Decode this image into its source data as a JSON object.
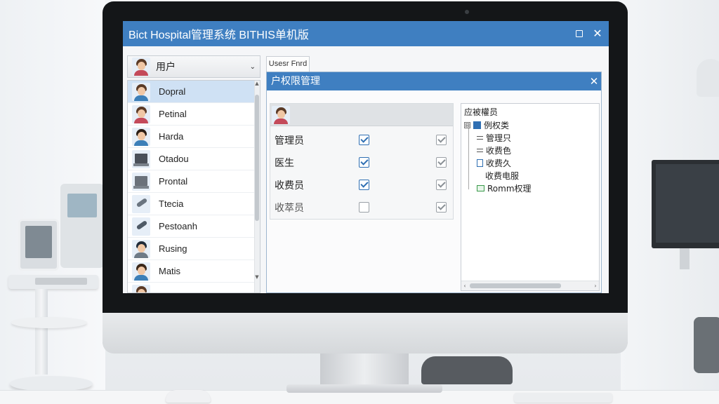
{
  "window": {
    "title": "Bict Hospital管理系统 BITHIS单机版",
    "maximize_label": "",
    "close_label": "✕"
  },
  "user_selector": {
    "label": "用户",
    "chevron": "⌄"
  },
  "user_list": [
    {
      "name": "Dopral",
      "avatar": "doctor-male"
    },
    {
      "name": "Petinal",
      "avatar": "person-female"
    },
    {
      "name": "Harda",
      "avatar": "person-female"
    },
    {
      "name": "Otadou",
      "avatar": "device"
    },
    {
      "name": "Prontal",
      "avatar": "device"
    },
    {
      "name": "Ttecia",
      "avatar": "tool"
    },
    {
      "name": "Pestoanh",
      "avatar": "tool"
    },
    {
      "name": "Rusing",
      "avatar": "person-male"
    },
    {
      "name": "Matis",
      "avatar": "person-male"
    }
  ],
  "tab": {
    "label": "Usesr Fnrd"
  },
  "dialog": {
    "title": "户权限管理",
    "close_label": "✕",
    "roles": [
      {
        "name": "管理员",
        "checked": true,
        "checked_right": true
      },
      {
        "name": "医生",
        "checked": true,
        "checked_right": true
      },
      {
        "name": "收费员",
        "checked": true,
        "checked_right": true
      },
      {
        "name": "收萃员",
        "checked": false,
        "checked_right": true
      }
    ],
    "tree": {
      "heading": "应被權员",
      "nodes": [
        {
          "label": "例权类",
          "expander": "⊟"
        },
        {
          "label": "管理只"
        },
        {
          "label": "收费色"
        },
        {
          "label": "收费久"
        },
        {
          "label": "收费电服"
        },
        {
          "label": "Romm权理"
        }
      ],
      "scroll_left": "‹",
      "scroll_right": "›"
    }
  },
  "colors": {
    "titlebar": "#3f7fc1",
    "selection": "#cfe1f4",
    "check_blue": "#2f6fb3"
  }
}
